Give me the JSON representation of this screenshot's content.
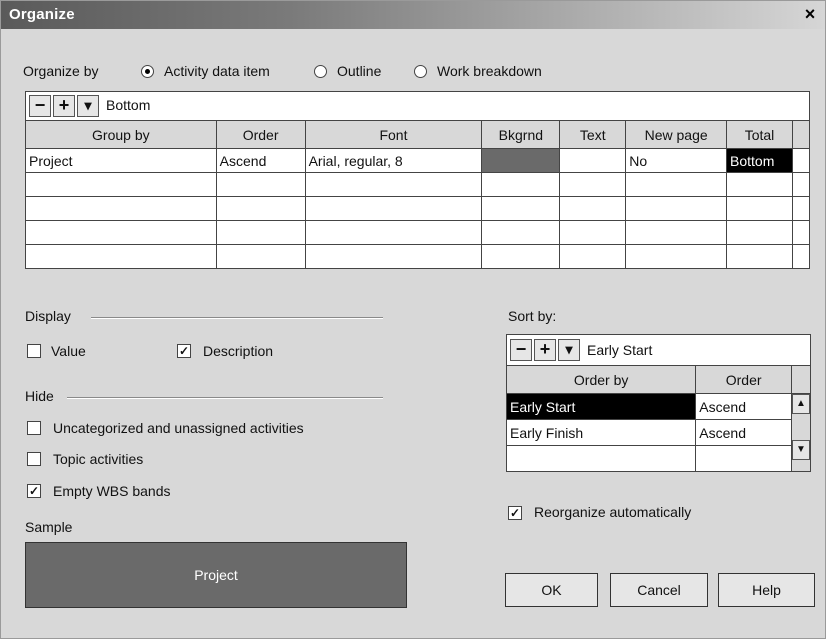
{
  "window": {
    "title": "Organize",
    "close": "×"
  },
  "organize_by": {
    "label": "Organize by",
    "options": [
      "Activity data item",
      "Outline",
      "Work breakdown"
    ],
    "selected": "Activity data item"
  },
  "group_toolbar": {
    "minus": "−",
    "plus": "+",
    "dropdown": "▾",
    "value": "Bottom"
  },
  "group_table": {
    "headers": [
      "Group by",
      "Order",
      "Font",
      "Bkgrnd",
      "Text",
      "New page",
      "Total"
    ],
    "rows": [
      {
        "group_by": "Project",
        "order": "Ascend",
        "font": "Arial, regular, 8",
        "bkgrnd": "#6a6a6a",
        "text": "",
        "new_page": "No",
        "total": "Bottom"
      }
    ]
  },
  "display": {
    "label": "Display",
    "value_label": "Value",
    "value_checked": false,
    "description_label": "Description",
    "description_checked": true
  },
  "hide": {
    "label": "Hide",
    "uncategorized_label": "Uncategorized and unassigned activities",
    "uncategorized_checked": false,
    "topic_label": "Topic activities",
    "topic_checked": false,
    "empty_wbs_label": "Empty WBS bands",
    "empty_wbs_checked": true
  },
  "sample": {
    "label": "Sample",
    "text": "Project",
    "bg": "#6a6a6a"
  },
  "sort": {
    "label": "Sort by:",
    "toolbar_value": "Early Start",
    "headers": [
      "Order by",
      "Order"
    ],
    "rows": [
      {
        "order_by": "Early Start",
        "order": "Ascend",
        "selected": true
      },
      {
        "order_by": "Early Finish",
        "order": "Ascend",
        "selected": false
      }
    ]
  },
  "reorganize": {
    "label": "Reorganize automatically",
    "checked": true
  },
  "buttons": {
    "ok": "OK",
    "cancel": "Cancel",
    "help": "Help"
  }
}
